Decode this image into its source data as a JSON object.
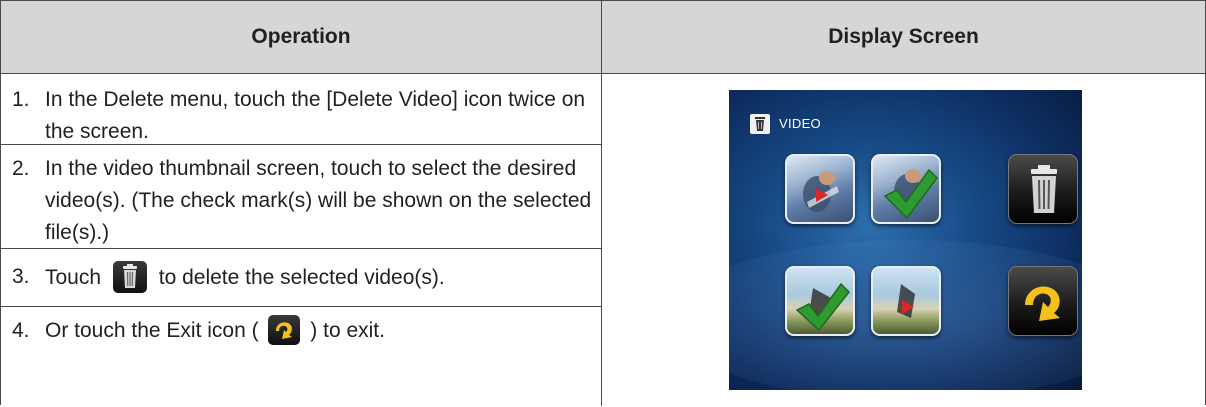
{
  "header": {
    "operation": "Operation",
    "display_screen": "Display Screen"
  },
  "steps": [
    {
      "number": "1.",
      "text": "In the Delete menu, touch the [Delete Video] icon twice on the screen."
    },
    {
      "number": "2.",
      "text": "In the video thumbnail screen, touch to select the desired video(s). (The check mark(s) will be shown on the selected file(s).)"
    },
    {
      "number": "3.",
      "before": "Touch",
      "after": "to delete the selected video(s).",
      "icon": "trash-icon"
    },
    {
      "number": "4.",
      "before": "Or touch the Exit icon (",
      "after": ") to exit.",
      "icon": "exit-icon"
    }
  ],
  "device": {
    "title": "VIDEO",
    "title_icon": "trash-icon",
    "tiles": [
      {
        "kind": "video-thumbnail",
        "state": "play",
        "icon": "play-icon"
      },
      {
        "kind": "video-thumbnail",
        "state": "checked",
        "icon": "check-icon"
      },
      {
        "kind": "button",
        "icon": "trash-icon"
      },
      {
        "kind": "video-thumbnail",
        "state": "checked",
        "icon": "check-icon"
      },
      {
        "kind": "video-thumbnail",
        "state": "play",
        "icon": "play-icon"
      },
      {
        "kind": "button",
        "icon": "exit-icon"
      }
    ]
  },
  "colors": {
    "header_background": "#d6d6d6",
    "border": "#4a4a4a",
    "text": "#231f20",
    "screen_blue": "#174a86",
    "check_green": "#2f9a2f",
    "exit_yellow": "#f2c21b",
    "play_red": "#d8262b"
  }
}
